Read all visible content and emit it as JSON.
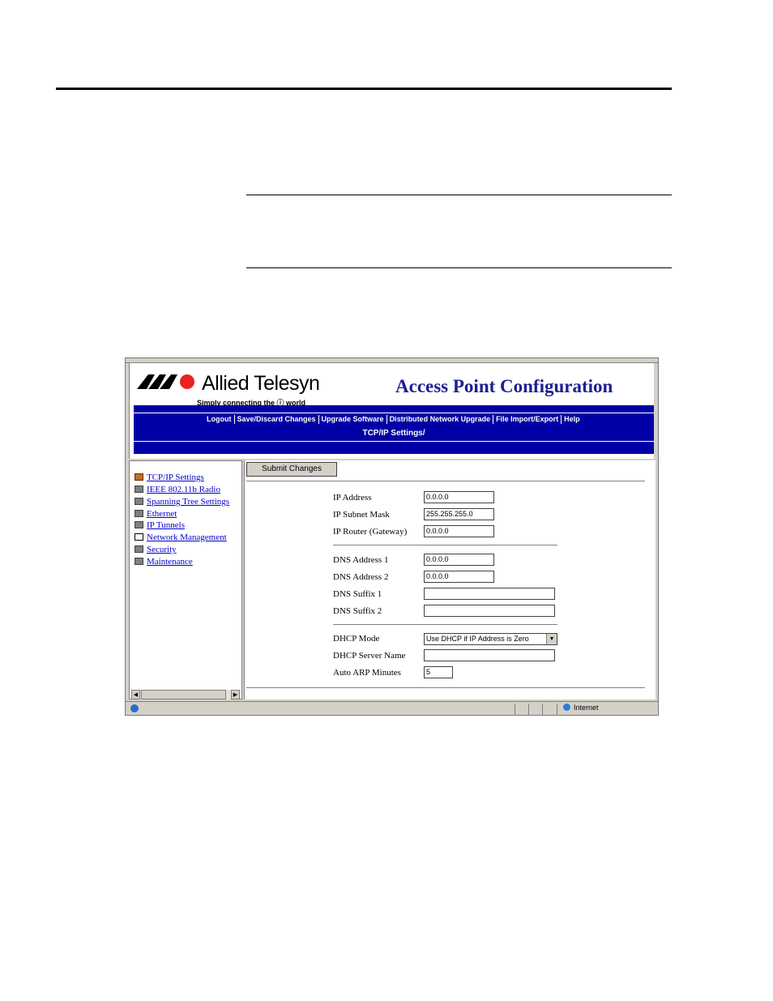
{
  "brand": {
    "name": "Allied Telesyn",
    "tagline": "Simply connecting the ⓘ world"
  },
  "header": {
    "title": "Access Point Configuration"
  },
  "nav": {
    "links": [
      "Logout",
      "Save/Discard Changes",
      "Upgrade Software",
      "Distributed Network Upgrade",
      "File Import/Export",
      "Help"
    ],
    "breadcrumb": "TCP/IP Settings/"
  },
  "tree": {
    "items": [
      {
        "label": "TCP/IP Settings",
        "icon": "active-page-icon"
      },
      {
        "label": "IEEE 802.11b Radio",
        "icon": "folder-icon"
      },
      {
        "label": "Spanning Tree Settings",
        "icon": "folder-icon"
      },
      {
        "label": "Ethernet",
        "icon": "folder-icon"
      },
      {
        "label": "IP Tunnels",
        "icon": "folder-icon"
      },
      {
        "label": "Network Management",
        "icon": "document-icon"
      },
      {
        "label": "Security",
        "icon": "folder-icon"
      },
      {
        "label": "Maintenance",
        "icon": "folder-icon"
      }
    ]
  },
  "form": {
    "submit_label": "Submit Changes",
    "fields": {
      "ip_address": {
        "label": "IP Address",
        "value": "0.0.0.0"
      },
      "ip_subnet_mask": {
        "label": "IP Subnet Mask",
        "value": "255.255.255.0"
      },
      "ip_router": {
        "label": "IP Router (Gateway)",
        "value": "0.0.0.0"
      },
      "dns_address_1": {
        "label": "DNS Address 1",
        "value": "0.0.0.0"
      },
      "dns_address_2": {
        "label": "DNS Address 2",
        "value": "0.0.0.0"
      },
      "dns_suffix_1": {
        "label": "DNS Suffix 1",
        "value": ""
      },
      "dns_suffix_2": {
        "label": "DNS Suffix 2",
        "value": ""
      },
      "dhcp_mode": {
        "label": "DHCP Mode",
        "value": "Use DHCP if IP Address is Zero"
      },
      "dhcp_server_name": {
        "label": "DHCP Server Name",
        "value": ""
      },
      "auto_arp_minutes": {
        "label": "Auto ARP Minutes",
        "value": "5"
      }
    }
  },
  "statusbar": {
    "zone": "Internet"
  },
  "colors": {
    "nav_blue": "#0000a6",
    "title_blue": "#1c2090",
    "link_blue": "#0000cc"
  }
}
